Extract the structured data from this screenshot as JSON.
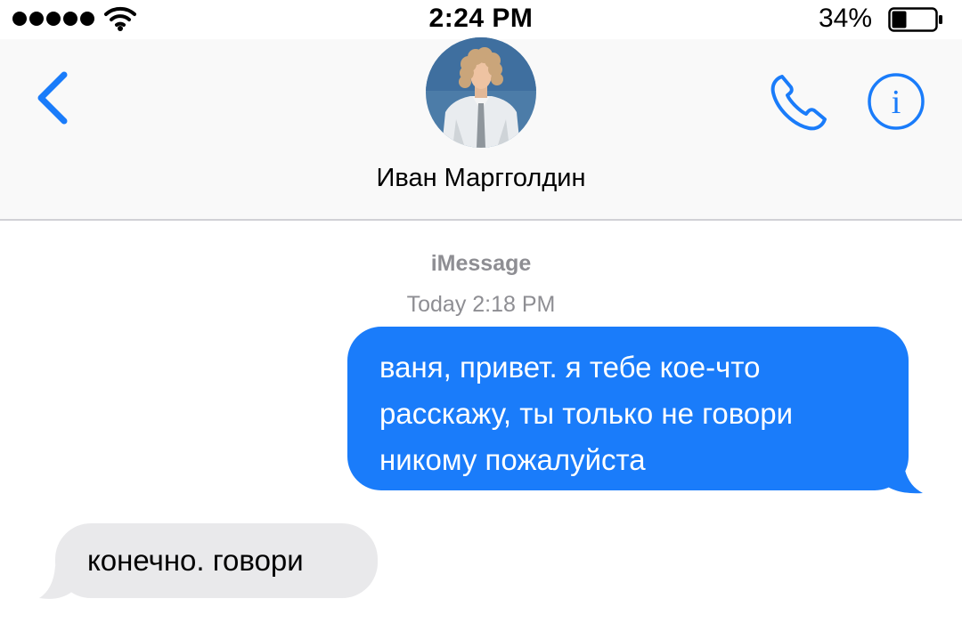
{
  "status_bar": {
    "time": "2:24 PM",
    "battery_percent": "34%",
    "battery_level": 0.34,
    "signal_icon": "signal-dots-icon",
    "wifi_icon": "wifi-icon"
  },
  "header": {
    "contact_name": "Иван Маргголдин",
    "back_icon": "chevron-left-icon",
    "call_icon": "phone-icon",
    "info_icon": "info-icon"
  },
  "conversation": {
    "service": "iMessage",
    "timestamp": "Today 2:18 PM",
    "messages": [
      {
        "direction": "outgoing",
        "lines": [
          "ваня, привет. я тебе кое-что",
          "расскажу, ты только не говори",
          "никому пожалуйста"
        ]
      },
      {
        "direction": "incoming",
        "text": "конечно. говори"
      }
    ]
  },
  "colors": {
    "accent": "#1a7cfa",
    "outgoing_bubble": "#1a7cfa",
    "incoming_bubble": "#e9e9eb",
    "meta_text": "#8e8e93"
  }
}
